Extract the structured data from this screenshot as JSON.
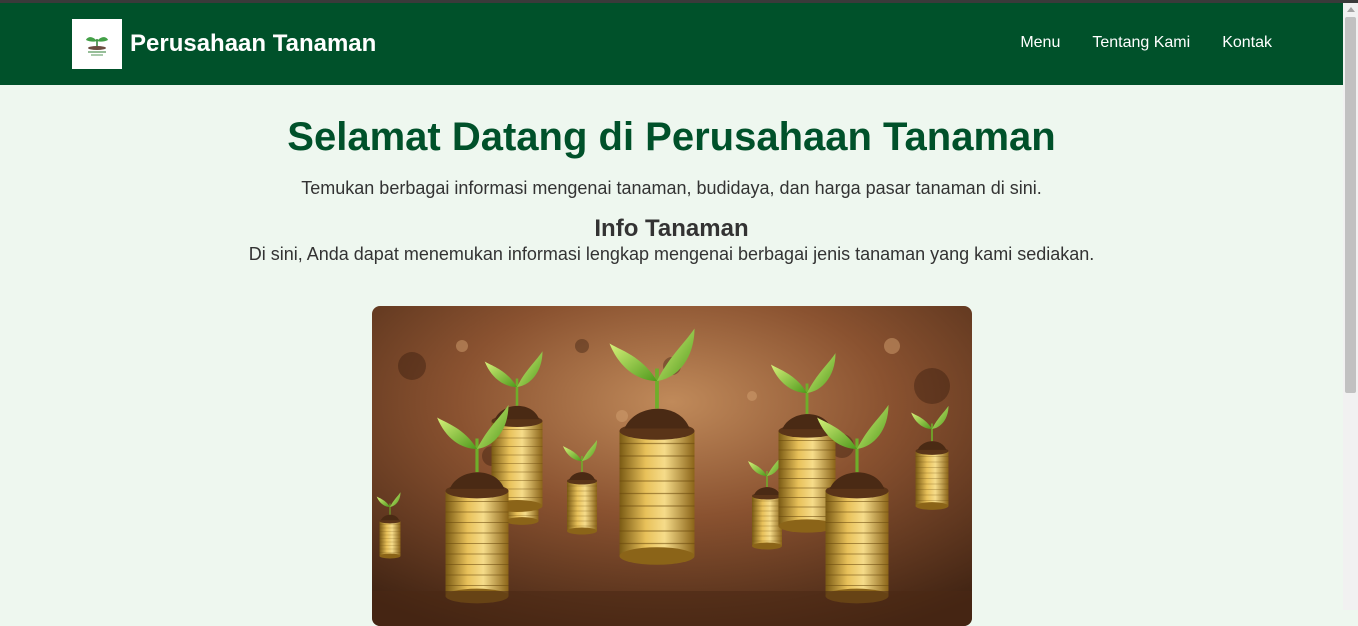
{
  "header": {
    "logo_icon": "sprout-logo-icon",
    "brand": "Perusahaan Tanaman",
    "nav": [
      "Menu",
      "Tentang Kami",
      "Kontak"
    ]
  },
  "hero": {
    "title": "Selamat Datang di Perusahaan Tanaman",
    "subtitle": "Temukan berbagai informasi mengenai tanaman, budidaya, dan harga pasar tanaman di sini."
  },
  "info": {
    "title": "Info Tanaman",
    "text": "Di sini, Anda dapat menemukan informasi lengkap mengenai berbagai jenis tanaman yang kami sediakan."
  },
  "image": {
    "subject": "coin-stacks-with-sprouts-image"
  },
  "colors": {
    "header_bg": "#00512a",
    "page_bg": "#eef7ef",
    "title_color": "#00512a"
  }
}
